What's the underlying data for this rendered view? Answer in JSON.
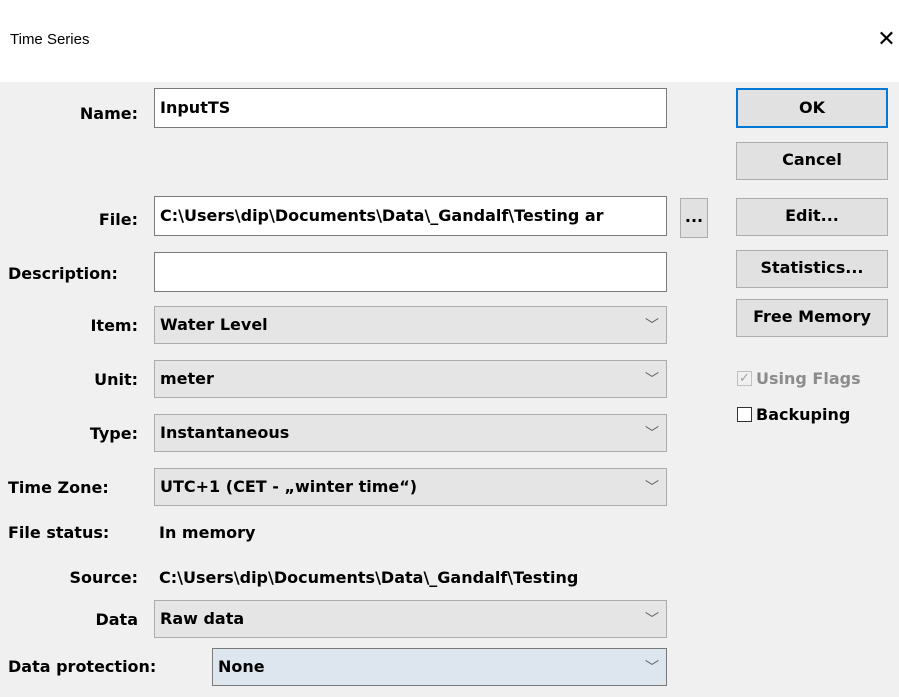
{
  "window": {
    "title": "Time Series",
    "close_glyph": "✕"
  },
  "labels": {
    "name": "Name:",
    "file": "File:",
    "description": "Description:",
    "item": "Item:",
    "unit": "Unit:",
    "type": "Type:",
    "time_zone": "Time Zone:",
    "file_status": "File status:",
    "source": "Source:",
    "data": "Data",
    "data_protection": "Data protection:"
  },
  "fields": {
    "name_value": "InputTS",
    "file_value": "C:\\Users\\dip\\Documents\\Data\\_Gandalf\\Testing ar",
    "description_value": "",
    "item_value": "Water Level",
    "unit_value": "meter",
    "type_value": "Instantaneous",
    "time_zone_value": "UTC+1 (CET - „winter time“)",
    "file_status_value": "In memory",
    "source_value": "C:\\Users\\dip\\Documents\\Data\\_Gandalf\\Testing",
    "data_value": "Raw data",
    "data_protection_value": "None"
  },
  "buttons": {
    "ok": "OK",
    "cancel": "Cancel",
    "browse": "...",
    "edit": "Edit...",
    "statistics": "Statistics...",
    "free_memory": "Free Memory"
  },
  "checkboxes": {
    "using_flags": {
      "label": "Using Flags",
      "checked": true,
      "enabled": false
    },
    "backuping": {
      "label": "Backuping",
      "checked": false,
      "enabled": true
    }
  },
  "icons": {
    "close": "close-icon",
    "dropdown": "chevron-down-icon",
    "check": "checkmark-icon"
  },
  "colors": {
    "window_bg": "#f0f0f0",
    "titlebar_bg": "#ffffff",
    "default_button_border": "#0078d7",
    "combo_bg": "#e5e5e5",
    "focused_combo_bg": "#dde6ef"
  }
}
